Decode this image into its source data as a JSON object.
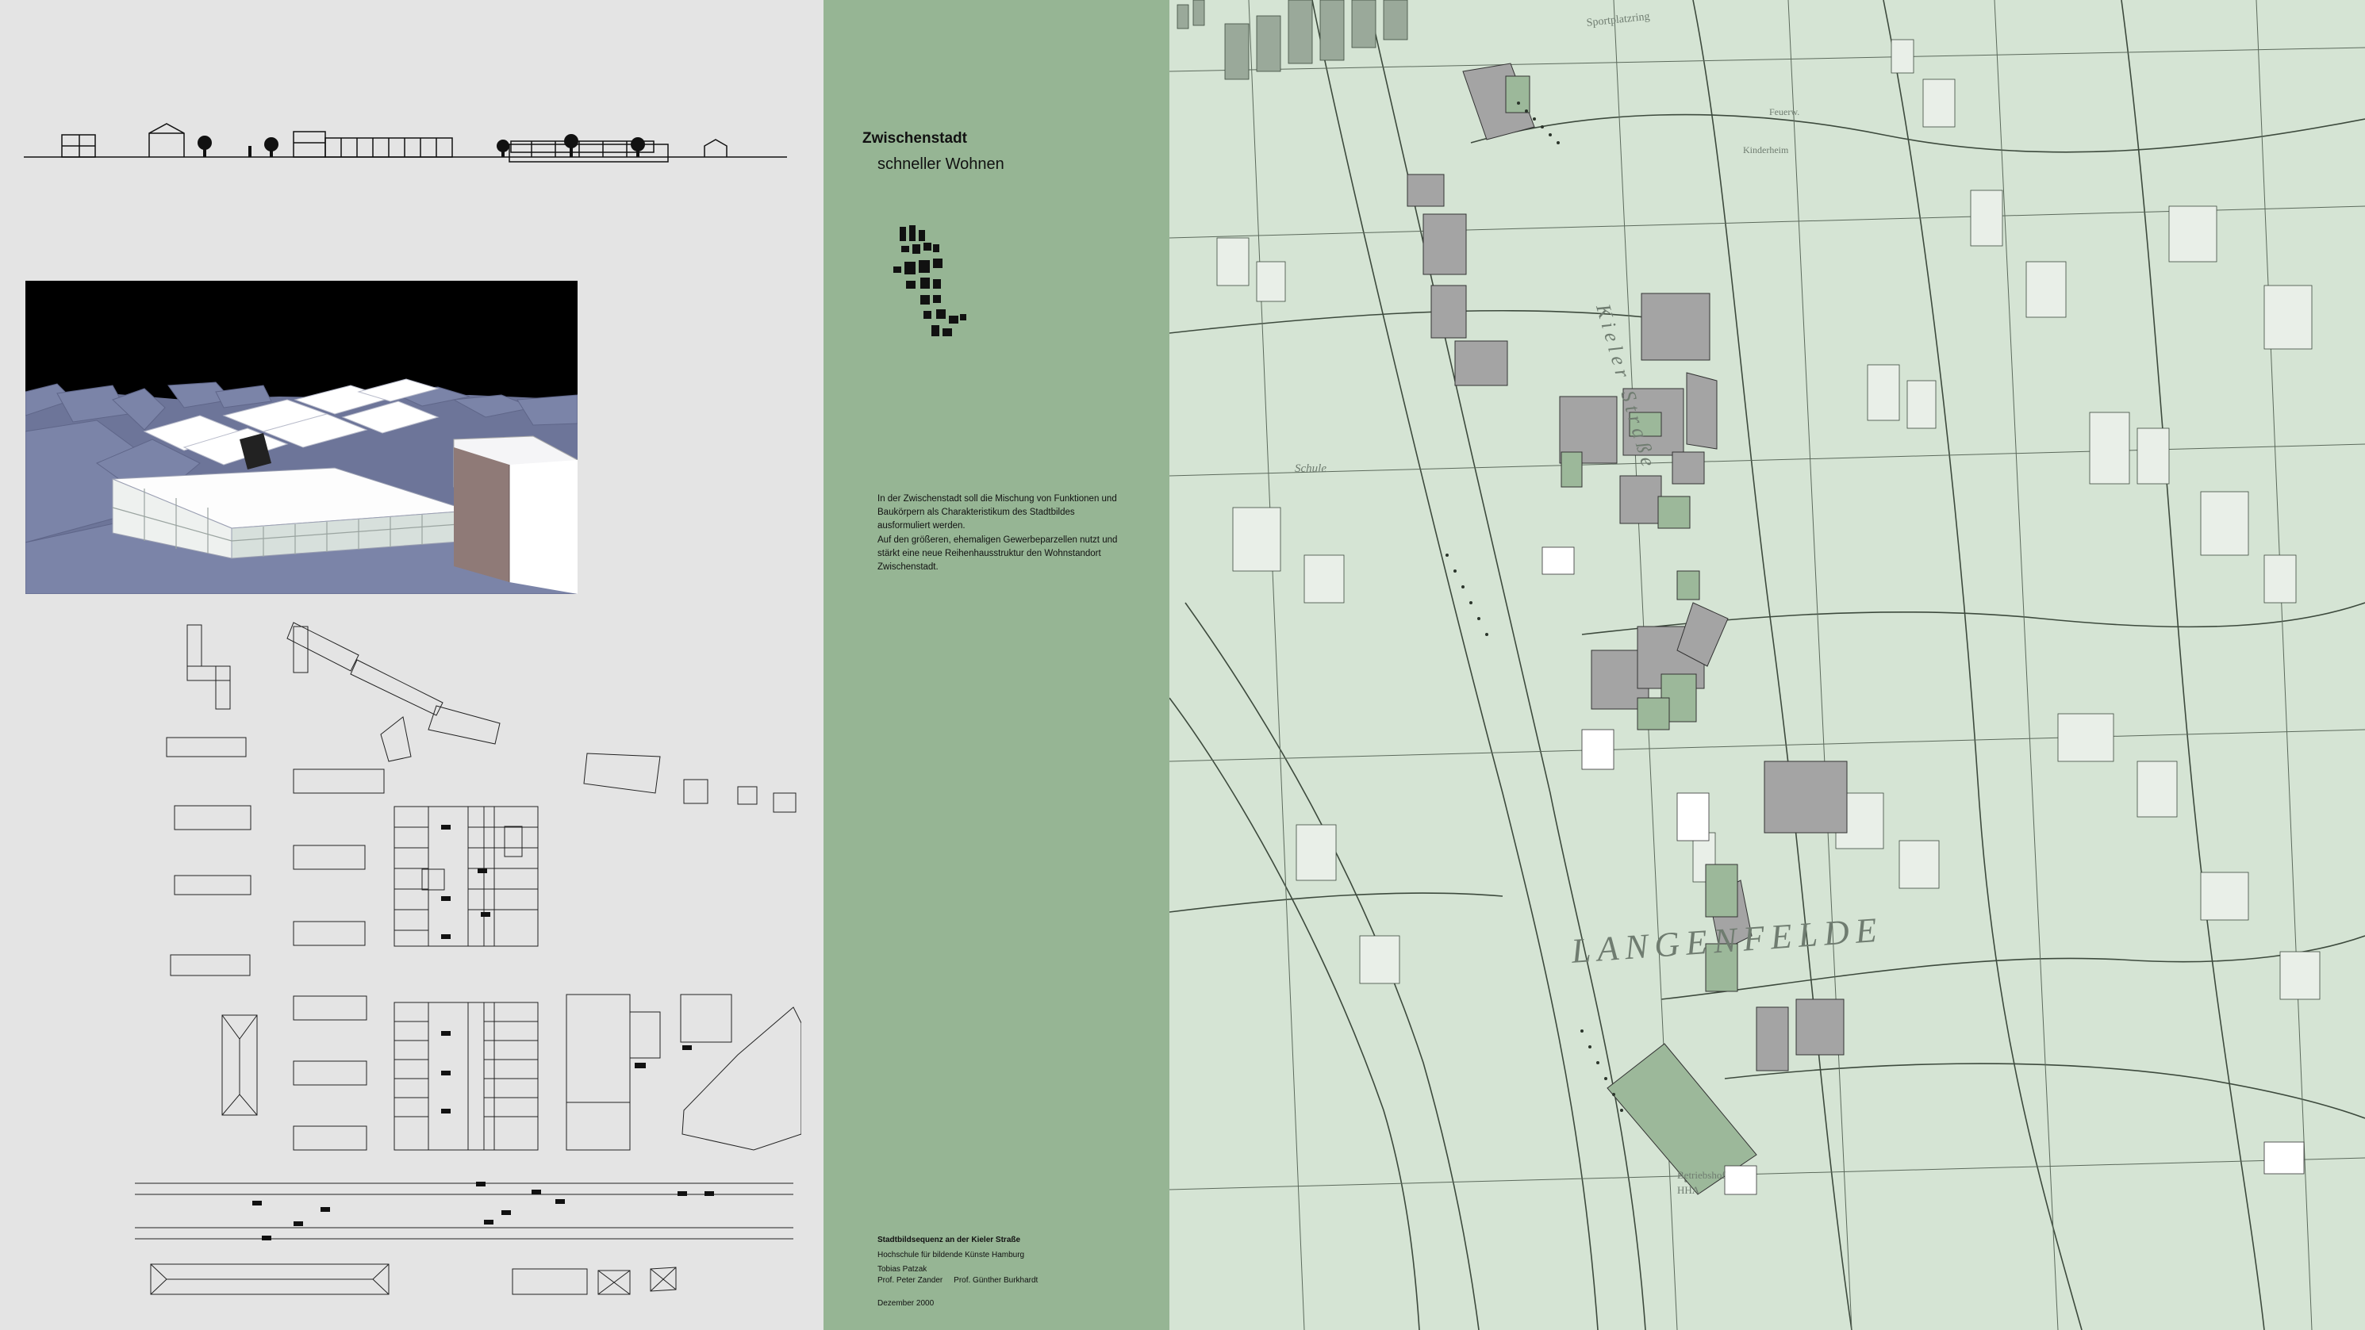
{
  "poster": {
    "title": "Zwischenstadt",
    "subtitle": "schneller Wohnen",
    "description": [
      "In der Zwischenstadt soll die Mischung von Funktionen und Baukörpern als Charakteristikum des Stadtbildes ausformuliert werden.",
      "Auf den größeren, ehemaligen Gewerbeparzellen nutzt und stärkt eine neue Reihenhausstruktur den Wohnstandort Zwischenstadt."
    ],
    "credits": {
      "project": "Stadtbildsequenz an der Kieler Straße",
      "school": "Hochschule für bildende Künste Hamburg",
      "author": "Tobias Patzak",
      "professors": "Prof. Peter Zander     Prof. Günther Burkhardt",
      "date": "Dezember 2000"
    }
  },
  "map": {
    "district_label": "LANGENFELDE",
    "street_label": "Kieler Straße",
    "school_label": "Schule",
    "hha_label": "Betriebshof",
    "hha_code": "HHA",
    "kita_label": "Kinderheim",
    "fire_label": "Feuerw.",
    "top_label": "Sportplatzring"
  },
  "colors": {
    "left_background": "#e4e4e4",
    "center_background": "#96b594",
    "map_background": "#d5e4d4",
    "new_buildings": "#8e8e8e",
    "green_roofs": "#9cb89a",
    "render_sky": "#000000",
    "render_context": "#7b84a8"
  },
  "icons": [
    "tree-icon",
    "car-icon"
  ]
}
